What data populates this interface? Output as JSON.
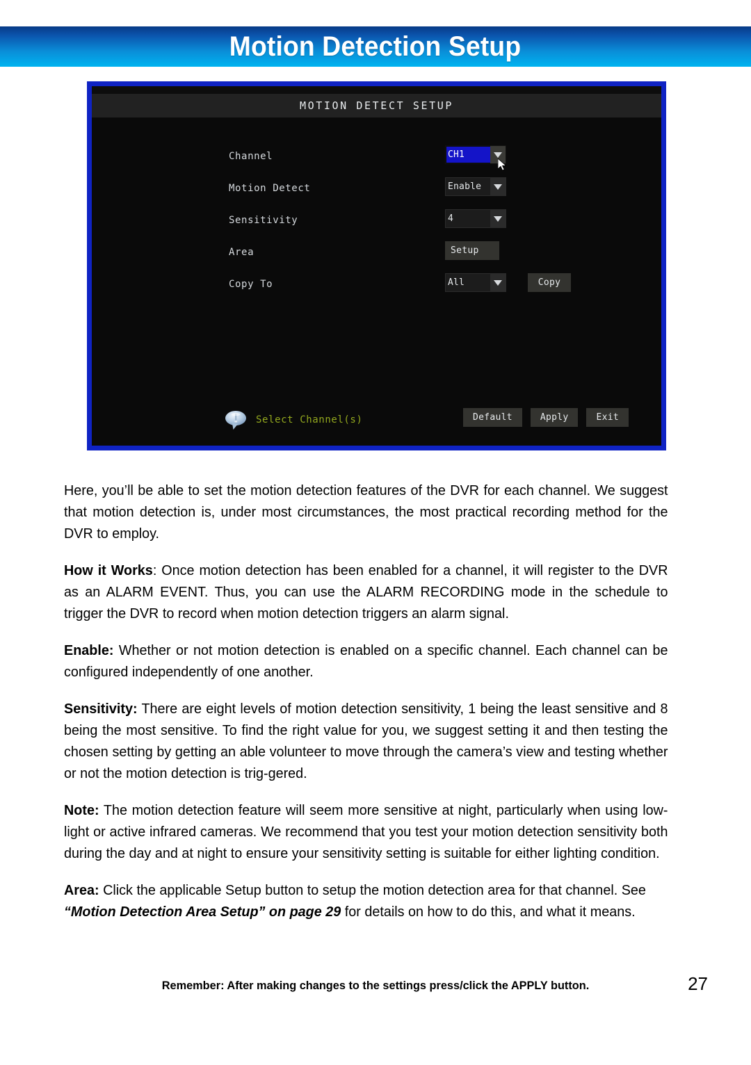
{
  "header": {
    "title": "Motion Detection Setup",
    "gradient_top": "#083a86",
    "gradient_bottom": "#00b3f0"
  },
  "dvr": {
    "window_title": "MOTION DETECT SETUP",
    "border_color": "#0f23c4",
    "rows": [
      {
        "label": "Channel",
        "control": "dropdown",
        "value": "CH1",
        "selected": true
      },
      {
        "label": "Motion Detect",
        "control": "dropdown",
        "value": "Enable",
        "selected": false
      },
      {
        "label": "Sensitivity",
        "control": "dropdown",
        "value": "4",
        "selected": false
      },
      {
        "label": "Area",
        "control": "button",
        "value": "Setup",
        "selected": false
      },
      {
        "label": "Copy To",
        "control": "dropdown",
        "value": "All",
        "selected": false
      }
    ],
    "copy_button": "Copy",
    "hint": {
      "icon": "info-balloon-icon",
      "text": "Select  Channel(s)",
      "color": "#93a81e"
    },
    "actions": [
      "Default",
      "Apply",
      "Exit"
    ]
  },
  "content": {
    "p1": "Here, you’ll be able to set the motion detection features of the DVR for each channel. We suggest that motion detection is, under most circumstances, the most practical recording method for the DVR to employ.",
    "p2_label": "How it Works",
    "p2_body": ": Once motion detection has been enabled for a channel, it will register to the DVR as an ALARM EVENT. Thus, you can use the ALARM RECORDING mode in the schedule to trigger the DVR to record when motion detection triggers an alarm signal.",
    "p3_label": "Enable:",
    "p3_body": " Whether or not motion detection is enabled on a specific channel. Each channel can be configured independently of one another.",
    "p4_label": "Sensitivity:",
    "p4_body": " There are eight levels of motion detection sensitivity, 1 being the least sensitive and 8 being the most sensitive. To find the right value for you, we suggest setting it and then testing the chosen setting by getting an able volunteer to move through the camera’s view and testing whether or not the motion detection is trig-gered.",
    "p5_label": "Note:",
    "p5_body": " The motion detection feature will seem more sensitive at night, particularly when using low-light or active infrared cameras. We recommend that you test your motion detection sensitivity both during the day and at night to ensure your sensitivity setting is suitable for either lighting condition.",
    "p6_label": "Area:",
    "p6_body_pre": " Click the applicable Setup button to setup the motion detection area for that channel. See ",
    "p6_ref": "“Motion Detection Area Setup” on page 29",
    "p6_body_post": " for details on how to do this, and what it means."
  },
  "footer": {
    "note": "Remember: After making changes to the settings press/click the APPLY button.",
    "page_number": "27"
  }
}
